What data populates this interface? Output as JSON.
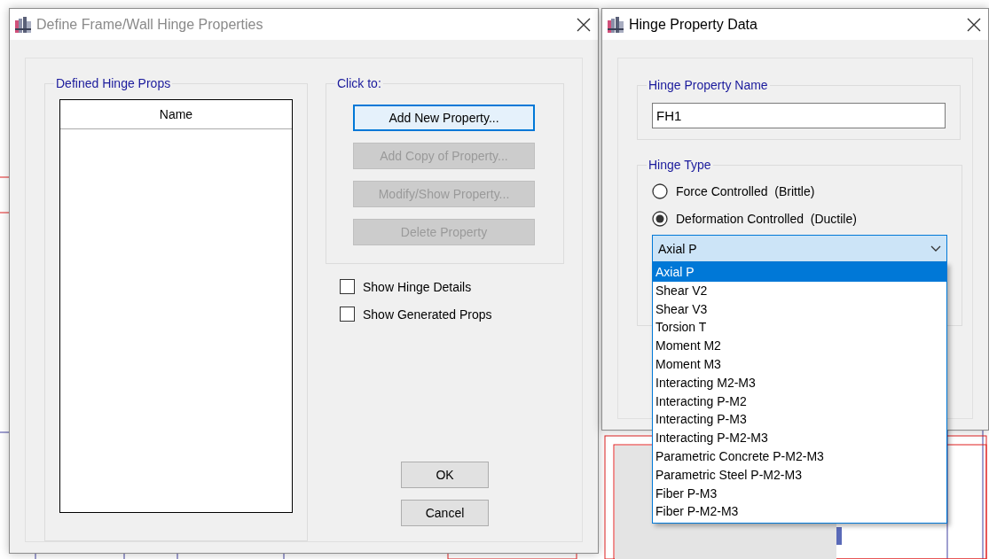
{
  "define_dialog": {
    "title": "Define Frame/Wall Hinge Properties",
    "active": false,
    "list_group": {
      "label": "Defined Hinge Props",
      "column_header": "Name"
    },
    "actions_group": {
      "label": "Click to:",
      "buttons": [
        {
          "label": "Add New Property...",
          "disabled": false,
          "focused": true
        },
        {
          "label": "Add Copy of Property...",
          "disabled": true,
          "focused": false
        },
        {
          "label": "Modify/Show Property...",
          "disabled": true,
          "focused": false
        },
        {
          "label": "Delete Property",
          "disabled": true,
          "focused": false
        }
      ]
    },
    "checkboxes": [
      {
        "label": "Show Hinge Details",
        "checked": false
      },
      {
        "label": "Show Generated Props",
        "checked": false
      }
    ],
    "buttons": [
      "OK",
      "Cancel"
    ]
  },
  "hinge_dialog": {
    "title": "Hinge Property Data",
    "active": true,
    "name_group": {
      "label": "Hinge Property Name",
      "value": "FH1"
    },
    "type_group": {
      "label": "Hinge Type",
      "options": [
        {
          "label": "Force Controlled  (Brittle)",
          "selected": false
        },
        {
          "label": "Deformation Controlled  (Ductile)",
          "selected": true
        }
      ],
      "dropdown": {
        "value": "Axial P",
        "open": true,
        "items": [
          {
            "label": "Axial P",
            "selected": true
          },
          {
            "label": "Shear V2",
            "selected": false
          },
          {
            "label": "Shear V3",
            "selected": false
          },
          {
            "label": "Torsion T",
            "selected": false
          },
          {
            "label": "Moment M2",
            "selected": false
          },
          {
            "label": "Moment M3",
            "selected": false
          },
          {
            "label": "Interacting M2-M3",
            "selected": false
          },
          {
            "label": "Interacting P-M2",
            "selected": false
          },
          {
            "label": "Interacting P-M3",
            "selected": false
          },
          {
            "label": "Interacting P-M2-M3",
            "selected": false
          },
          {
            "label": "Parametric Concrete P-M2-M3",
            "selected": false
          },
          {
            "label": "Parametric Steel P-M2-M3",
            "selected": false
          },
          {
            "label": "Fiber P-M3",
            "selected": false
          },
          {
            "label": "Fiber P-M2-M3",
            "selected": false
          }
        ]
      }
    }
  }
}
